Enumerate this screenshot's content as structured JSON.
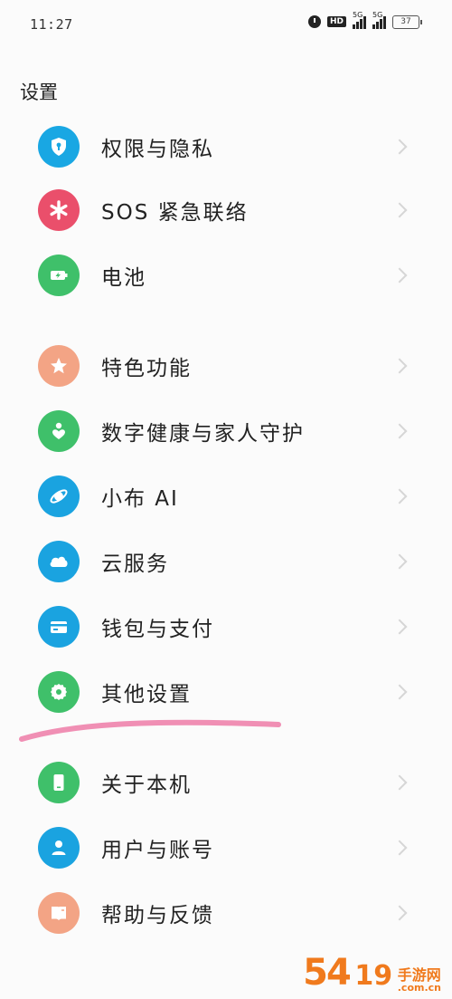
{
  "status_bar": {
    "time": "11:27",
    "hd_label": "HD",
    "signal1_label": "5G",
    "signal2_label": "5G",
    "battery": "37"
  },
  "page": {
    "title": "设置"
  },
  "items": [
    {
      "label": "权限与隐私",
      "icon": "shield-lock-icon",
      "color": "#19a7e3"
    },
    {
      "label": "SOS 紧急联络",
      "icon": "asterisk-icon",
      "color": "#ea4f6b"
    },
    {
      "label": "电池",
      "icon": "battery-icon",
      "color": "#3fc06a"
    },
    {
      "label": "特色功能",
      "icon": "star-icon",
      "color": "#f3a485"
    },
    {
      "label": "数字健康与家人守护",
      "icon": "person-heart-icon",
      "color": "#3fc06a"
    },
    {
      "label": "小布 AI",
      "icon": "orbit-icon",
      "color": "#1aa3e0"
    },
    {
      "label": "云服务",
      "icon": "cloud-icon",
      "color": "#1aa3e0"
    },
    {
      "label": "钱包与支付",
      "icon": "card-icon",
      "color": "#1aa3e0"
    },
    {
      "label": "其他设置",
      "icon": "gear-icon",
      "color": "#3fc06a"
    },
    {
      "label": "关于本机",
      "icon": "phone-icon",
      "color": "#3fc06a"
    },
    {
      "label": "用户与账号",
      "icon": "user-icon",
      "color": "#1aa3e0"
    },
    {
      "label": "帮助与反馈",
      "icon": "book-icon",
      "color": "#f3a485"
    }
  ],
  "watermark": {
    "number": "54",
    "text1": "手游网",
    "text2": ".com.cn"
  }
}
